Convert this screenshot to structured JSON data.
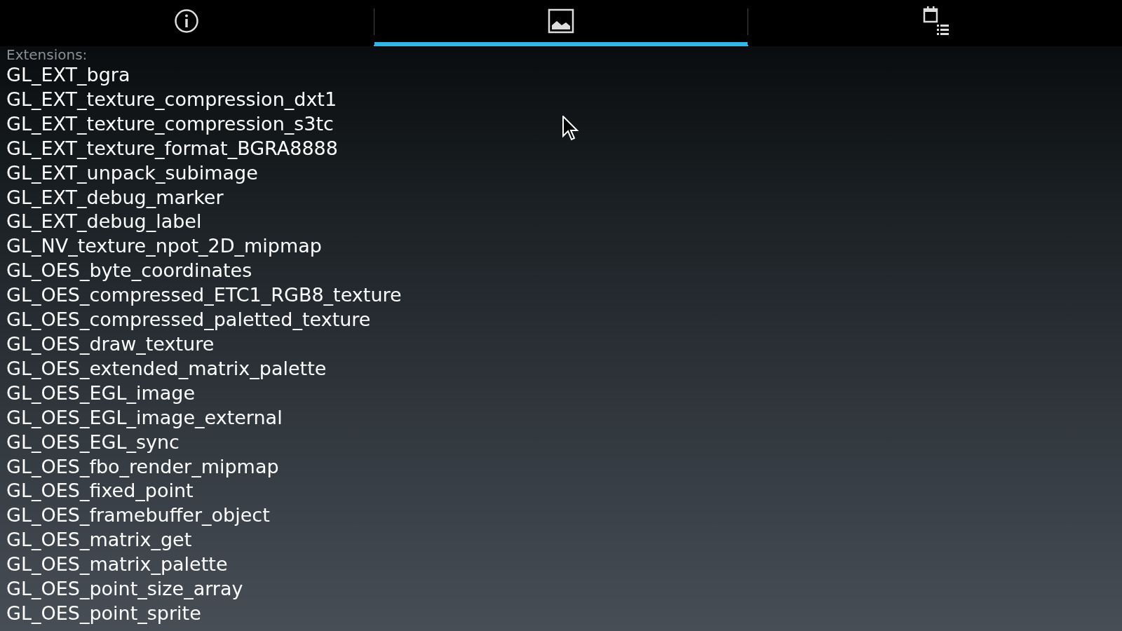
{
  "tabs": [
    {
      "kind": "info",
      "selected": false
    },
    {
      "kind": "image",
      "selected": true
    },
    {
      "kind": "calendar-list",
      "selected": false
    }
  ],
  "extensions": {
    "heading": "Extensions:",
    "items": [
      "GL_EXT_bgra",
      "GL_EXT_texture_compression_dxt1",
      "GL_EXT_texture_compression_s3tc",
      "GL_EXT_texture_format_BGRA8888",
      "GL_EXT_unpack_subimage",
      "GL_EXT_debug_marker",
      "GL_EXT_debug_label",
      "GL_NV_texture_npot_2D_mipmap",
      "GL_OES_byte_coordinates",
      "GL_OES_compressed_ETC1_RGB8_texture",
      "GL_OES_compressed_paletted_texture",
      "GL_OES_draw_texture",
      "GL_OES_extended_matrix_palette",
      "GL_OES_EGL_image",
      "GL_OES_EGL_image_external",
      "GL_OES_EGL_sync",
      "GL_OES_fbo_render_mipmap",
      "GL_OES_fixed_point",
      "GL_OES_framebuffer_object",
      "GL_OES_matrix_get",
      "GL_OES_matrix_palette",
      "GL_OES_point_size_array",
      "GL_OES_point_sprite"
    ]
  }
}
